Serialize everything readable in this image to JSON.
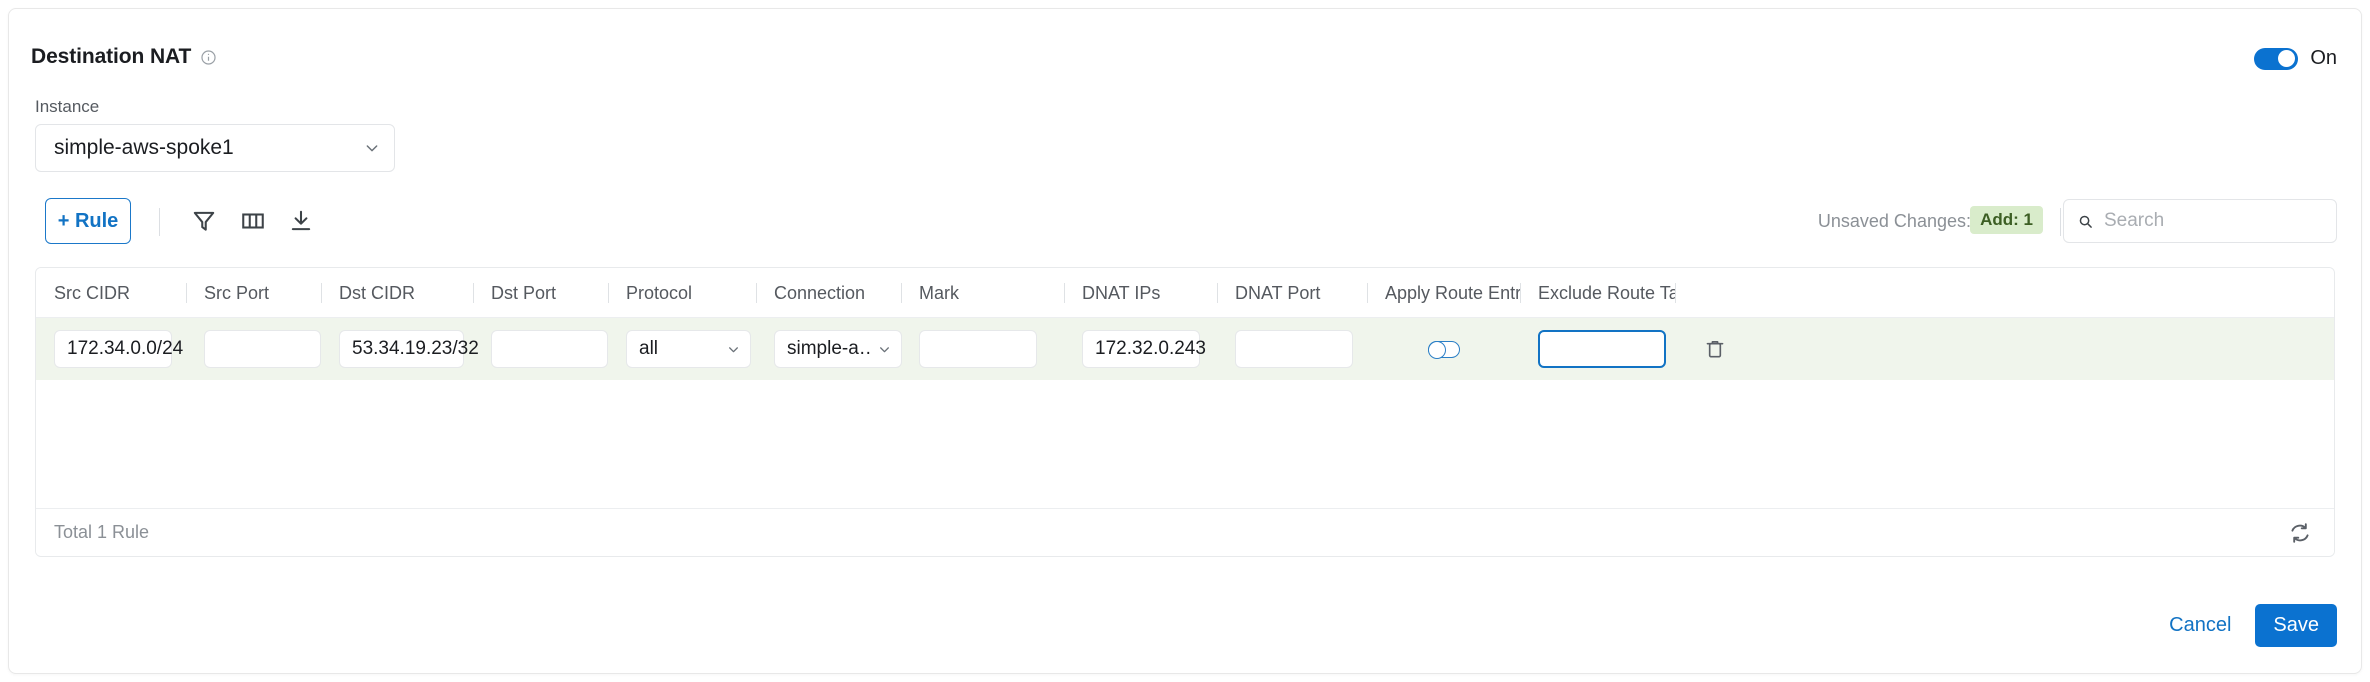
{
  "header": {
    "title": "Destination NAT",
    "info_icon": "info-circle-icon",
    "toggle_state": "on",
    "toggle_label": "On"
  },
  "instance": {
    "label": "Instance",
    "value": "simple-aws-spoke1",
    "chevron_icon": "chevron-down-icon"
  },
  "toolbar": {
    "add_rule_label": "+ Rule",
    "filter_icon": "filter-icon",
    "columns_icon": "columns-icon",
    "export_icon": "download-icon",
    "unsaved_changes_label": "Unsaved Changes:",
    "unsaved_badge": "Add: 1",
    "search_placeholder": "Search",
    "search_value": "",
    "search_icon": "search-icon"
  },
  "table": {
    "columns": [
      "Src CIDR",
      "Src Port",
      "Dst CIDR",
      "Dst Port",
      "Protocol",
      "Connection",
      "Mark",
      "DNAT IPs",
      "DNAT Port",
      "Apply Route Entry",
      "Exclude Route Table"
    ],
    "rows": [
      {
        "src_cidr": "172.34.0.0/24",
        "src_port": "",
        "dst_cidr": "53.34.19.23/32",
        "dst_port": "",
        "protocol": "all",
        "connection": "simple-a…",
        "mark": "",
        "dnat_ips": "172.32.0.243",
        "dnat_port": "",
        "apply_route_entry": "off",
        "exclude_route_table": "",
        "delete_icon": "trash-icon"
      }
    ],
    "total_text": "Total 1 Rule",
    "refresh_icon": "refresh-icon"
  },
  "footer": {
    "cancel_label": "Cancel",
    "save_label": "Save"
  },
  "colors": {
    "accent": "#0b72d0",
    "link": "#1273c4",
    "badge_bg": "#d9eccb",
    "badge_text": "#3c5e23",
    "row_bg": "#f0f5ec"
  }
}
